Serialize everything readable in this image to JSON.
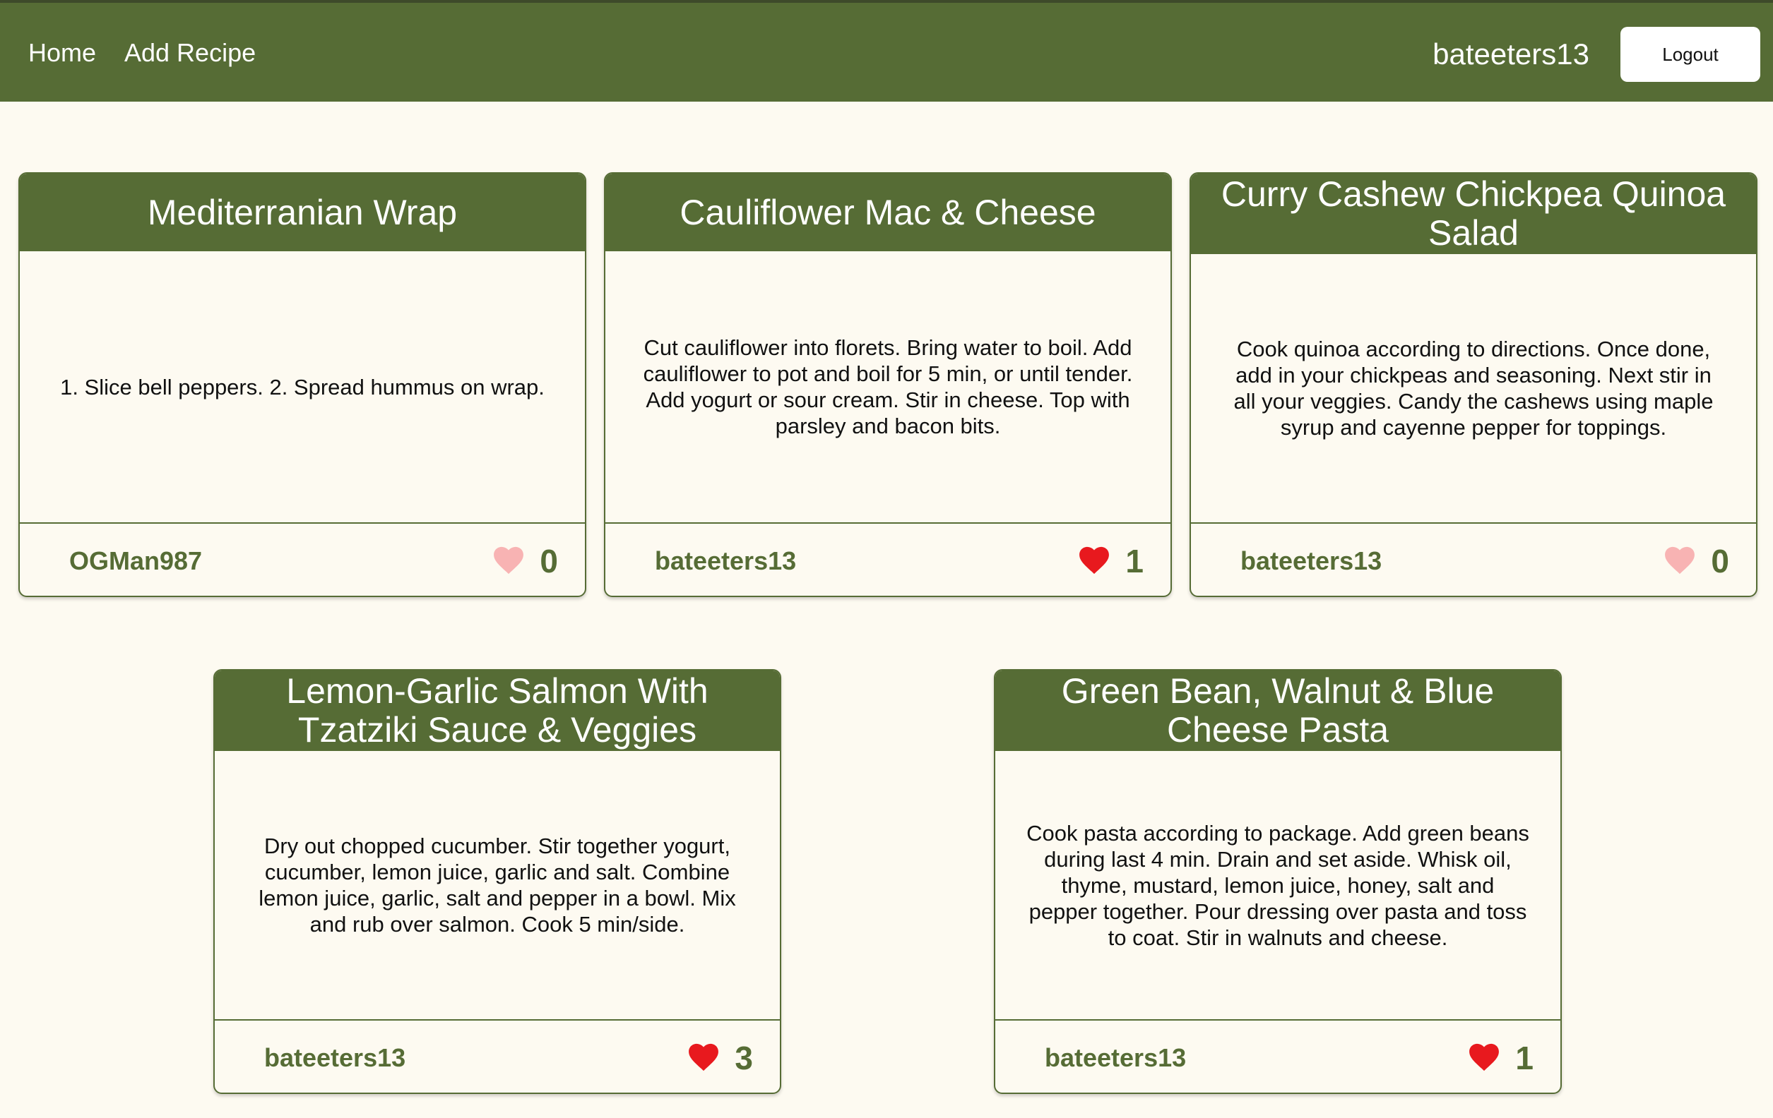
{
  "nav": {
    "home": "Home",
    "add_recipe": "Add Recipe",
    "username": "bateeters13",
    "logout": "Logout"
  },
  "colors": {
    "brand": "#566c35",
    "background": "#fdfaf1",
    "heart_liked": "#e8191e",
    "heart_unliked": "#f8b3b3"
  },
  "recipes": [
    {
      "title": "Mediterranian Wrap",
      "instructions": "1. Slice bell peppers. 2. Spread hummus on wrap.",
      "author": "OGMan987",
      "likes": "0",
      "liked": false
    },
    {
      "title": "Cauliflower Mac & Cheese",
      "instructions": "Cut cauliflower into florets. Bring water to boil. Add cauliflower to pot and boil for 5 min, or until tender. Add yogurt or sour cream. Stir in cheese. Top with parsley and bacon bits.",
      "author": "bateeters13",
      "likes": "1",
      "liked": true
    },
    {
      "title": "Curry Cashew Chickpea Quinoa Salad",
      "instructions": "Cook quinoa according to directions. Once done, add in your chickpeas and seasoning. Next stir in all your veggies. Candy the cashews using maple syrup and cayenne pepper for toppings.",
      "author": "bateeters13",
      "likes": "0",
      "liked": false
    },
    {
      "title": "Lemon-Garlic Salmon With Tzatziki Sauce & Veggies",
      "instructions": "Dry out chopped cucumber. Stir together yogurt, cucumber, lemon juice, garlic and salt. Combine lemon juice, garlic, salt and pepper in a bowl. Mix and rub over salmon. Cook 5 min/side.",
      "author": "bateeters13",
      "likes": "3",
      "liked": true
    },
    {
      "title": "Green Bean, Walnut & Blue Cheese Pasta",
      "instructions": "Cook pasta according to package. Add green beans during last 4 min. Drain and set aside. Whisk oil, thyme, mustard, lemon juice, honey, salt and pepper together. Pour dressing over pasta and toss to coat. Stir in walnuts and cheese.",
      "author": "bateeters13",
      "likes": "1",
      "liked": true
    }
  ]
}
